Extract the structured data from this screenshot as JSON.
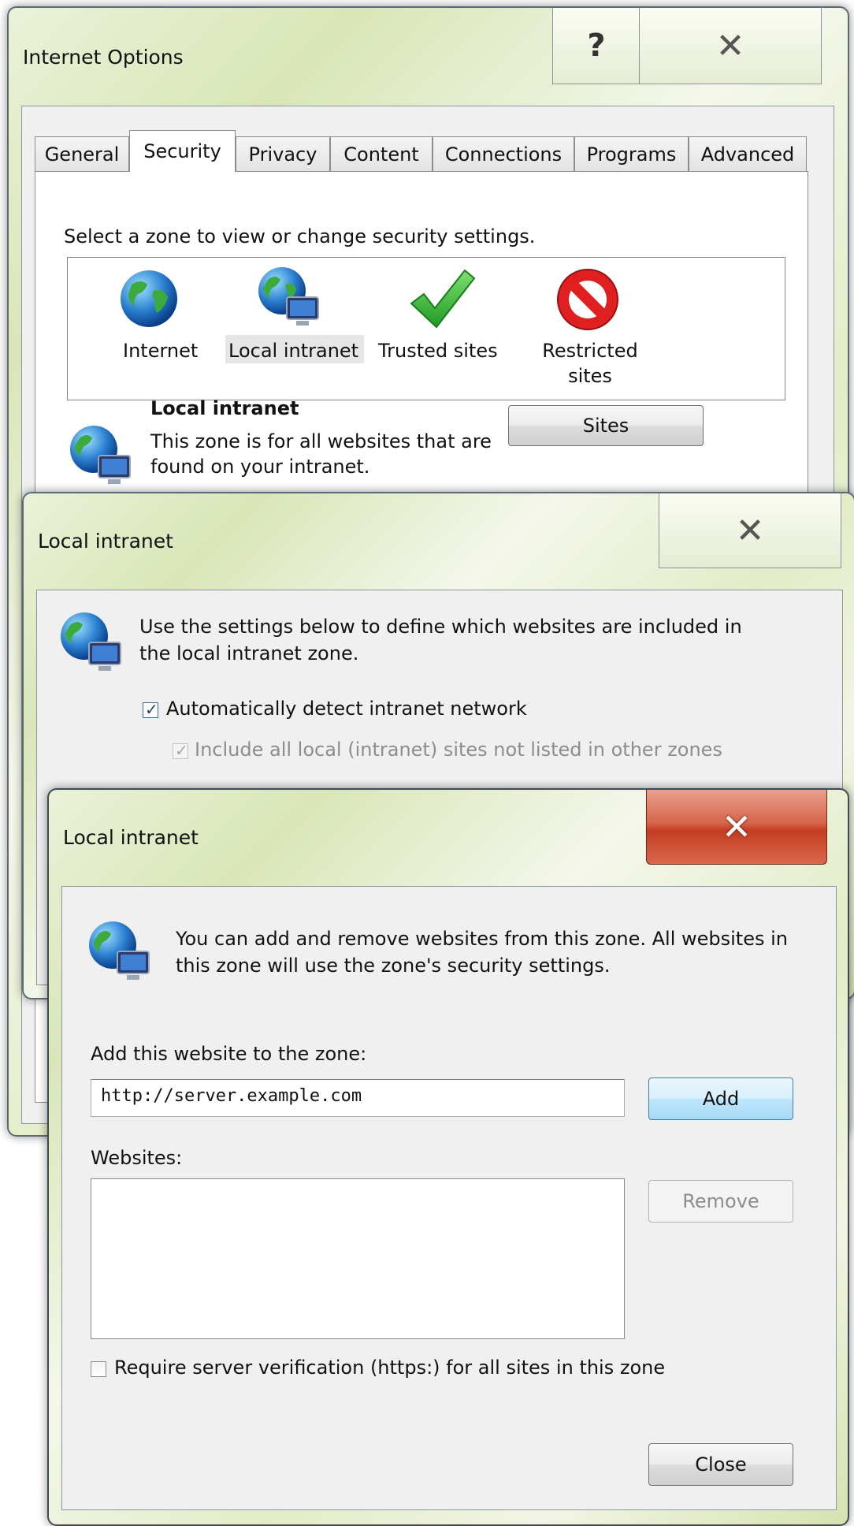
{
  "internet_options": {
    "title": "Internet Options",
    "tabs": [
      {
        "label": "General"
      },
      {
        "label": "Security"
      },
      {
        "label": "Privacy"
      },
      {
        "label": "Content"
      },
      {
        "label": "Connections"
      },
      {
        "label": "Programs"
      },
      {
        "label": "Advanced"
      }
    ],
    "active_tab": "Security",
    "zone_prompt": "Select a zone to view or change security settings.",
    "zones": [
      {
        "label": "Internet",
        "icon": "globe-icon"
      },
      {
        "label": "Local intranet",
        "icon": "intranet-globe-icon"
      },
      {
        "label": "Trusted sites",
        "icon": "green-checkmark-icon"
      },
      {
        "label": "Restricted sites",
        "icon": "no-entry-icon"
      }
    ],
    "selected_zone": "Local intranet",
    "zone_heading": "Local intranet",
    "zone_desc_line1": "This zone is for all websites that are",
    "zone_desc_line2": "found on your intranet.",
    "sites_button": "Sites"
  },
  "intranet_dialog": {
    "title": "Local intranet",
    "intro_line1": "Use the settings below to define which websites are included in",
    "intro_line2": "the local intranet zone.",
    "auto_detect_label": "Automatically detect intranet network",
    "auto_detect_checked": true,
    "include_local_label": "Include all local (intranet) sites not listed in other zones",
    "include_local_checked": true,
    "include_local_disabled": true
  },
  "sites_dialog": {
    "title": "Local intranet",
    "intro_line1": "You can add and remove websites from this zone. All websites in",
    "intro_line2": "this zone will use the zone's security settings.",
    "add_label": "Add this website to the zone:",
    "add_value": "http://server.example.com",
    "add_button": "Add",
    "websites_label": "Websites:",
    "websites": [],
    "remove_button": "Remove",
    "require_https_label": "Require server verification (https:) for all sites in this zone",
    "require_https_checked": false,
    "close_button": "Close"
  },
  "colors": {
    "close_red": "#c8422c",
    "glass_green": "#dbe8bc",
    "dialog_bg": "#f0f0f0"
  }
}
